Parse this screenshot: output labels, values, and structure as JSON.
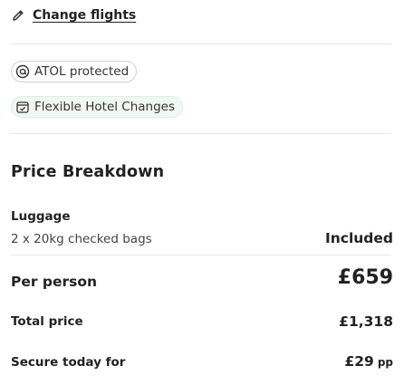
{
  "header": {
    "change_flights_label": "Change flights",
    "change_flights_icon": "pencil-icon"
  },
  "badges": {
    "atol": {
      "label": "ATOL protected",
      "icon": "atol-shield-icon"
    },
    "hotel": {
      "label": "Flexible Hotel Changes",
      "icon": "calendar-check-icon"
    }
  },
  "price_breakdown": {
    "title": "Price Breakdown",
    "luggage": {
      "title": "Luggage",
      "description": "2 x 20kg checked bags",
      "value": "Included"
    },
    "per_person": {
      "label": "Per person",
      "value": "£659"
    },
    "total_price": {
      "label": "Total price",
      "value": "£1,318"
    },
    "secure_today": {
      "label": "Secure today for",
      "amount": "£29",
      "suffix": "pp"
    }
  },
  "colors": {
    "text": "#222222",
    "muted_text": "#444444",
    "divider": "#e8e8e8",
    "hotel_badge_bg": "#f3f7f4",
    "hotel_badge_border": "#dbeee2"
  }
}
